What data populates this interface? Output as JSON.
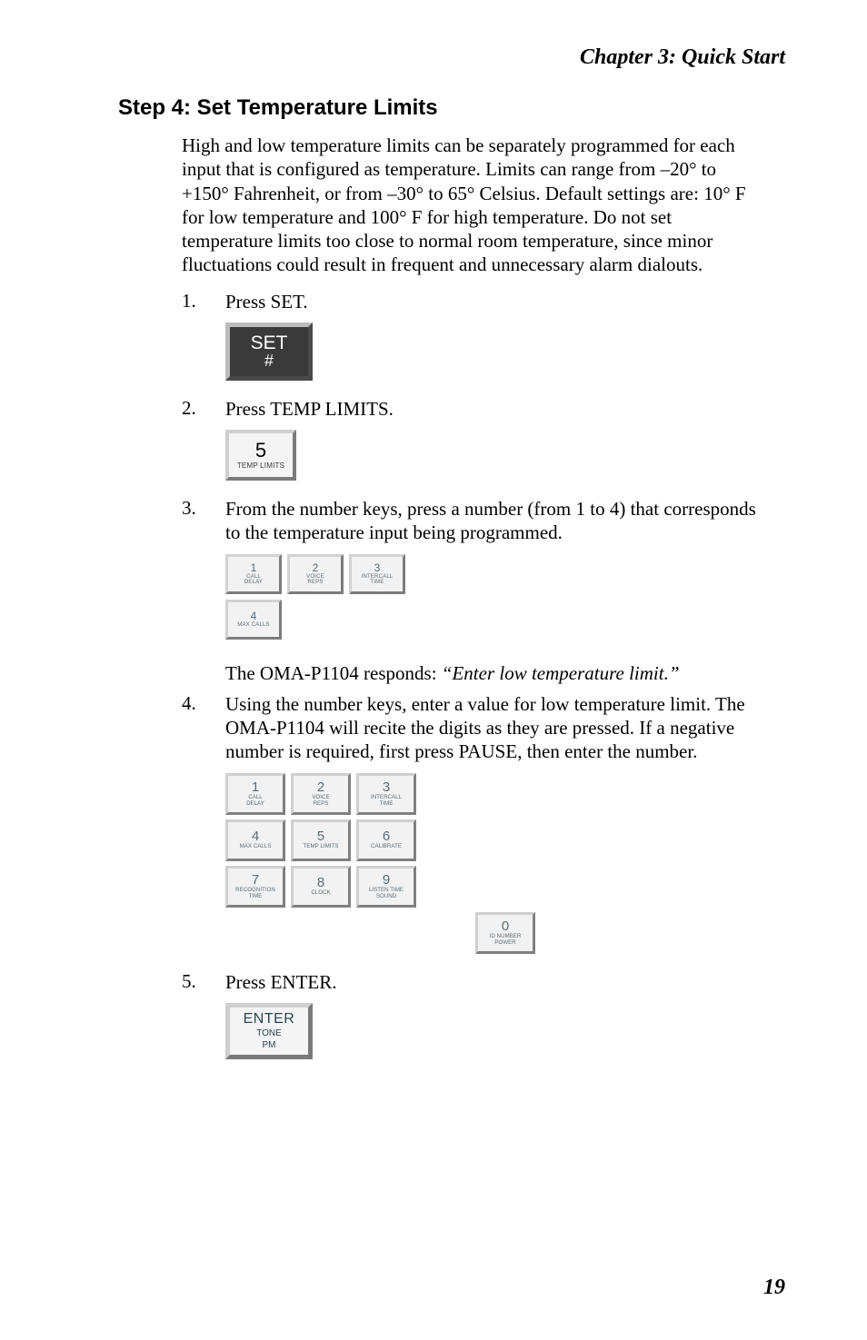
{
  "chapter_header": "Chapter 3:  Quick Start",
  "step_title": "Step 4:  Set Temperature Limits",
  "intro_para": "High and low temperature limits can be separately programmed for each input that is configured as temperature. Limits can range from –20°  to +150° Fahrenheit, or from –30° to 65° Celsius. Default settings are: 10° F for low temperature and 100° F for high temperature. Do not set temperature limits too close to normal room temperature, since minor fluctuations could result in frequent and unnecessary alarm dialouts.",
  "steps": {
    "s1": {
      "num": "1.",
      "text": "Press SET."
    },
    "s2": {
      "num": "2.",
      "text": "Press TEMP LIMITS."
    },
    "s3": {
      "num": "3.",
      "text": "From the number keys, press a number (from 1 to 4) that corresponds to the temperature input being programmed."
    },
    "s4": {
      "num": "4.",
      "text": "Using the number keys, enter a value for low temperature limit. The OMA-P1104 will recite the digits as they are pressed. If a negative number is required, first press PAUSE, then enter the number."
    },
    "s5": {
      "num": "5.",
      "text": "Press ENTER."
    }
  },
  "response_prefix": "The OMA-P1104 responds: ",
  "response_quote": "“Enter low temperature limit.”",
  "set_button": {
    "top": "SET",
    "bottom": "#"
  },
  "key5": {
    "num": "5",
    "label": "TEMP LIMITS"
  },
  "keys14": {
    "k1": {
      "n": "1",
      "l": "CALL\nDELAY"
    },
    "k2": {
      "n": "2",
      "l": "VOICE\nREPS"
    },
    "k3": {
      "n": "3",
      "l": "INTERCALL\nTIME"
    },
    "k4": {
      "n": "4",
      "l": "MAX CALLS"
    }
  },
  "fullpad": {
    "r1": [
      {
        "n": "1",
        "l": "CALL\nDELAY"
      },
      {
        "n": "2",
        "l": "VOICE\nREPS"
      },
      {
        "n": "3",
        "l": "INTERCALL\nTIME"
      }
    ],
    "r2": [
      {
        "n": "4",
        "l": "MAX CALLS"
      },
      {
        "n": "5",
        "l": "TEMP LIMITS"
      },
      {
        "n": "6",
        "l": "CALIBRATE"
      }
    ],
    "r3": [
      {
        "n": "7",
        "l": "RECOGNITION\nTIME"
      },
      {
        "n": "8",
        "l": "CLOCK"
      },
      {
        "n": "9",
        "l": "LISTEN TIME\nSOUND"
      }
    ],
    "r4": [
      {
        "n": "0",
        "l": "ID NUMBER\nPOWER"
      }
    ]
  },
  "enter_button": {
    "top": "ENTER",
    "mid": "TONE",
    "bot": "PM"
  },
  "page_number": "19"
}
